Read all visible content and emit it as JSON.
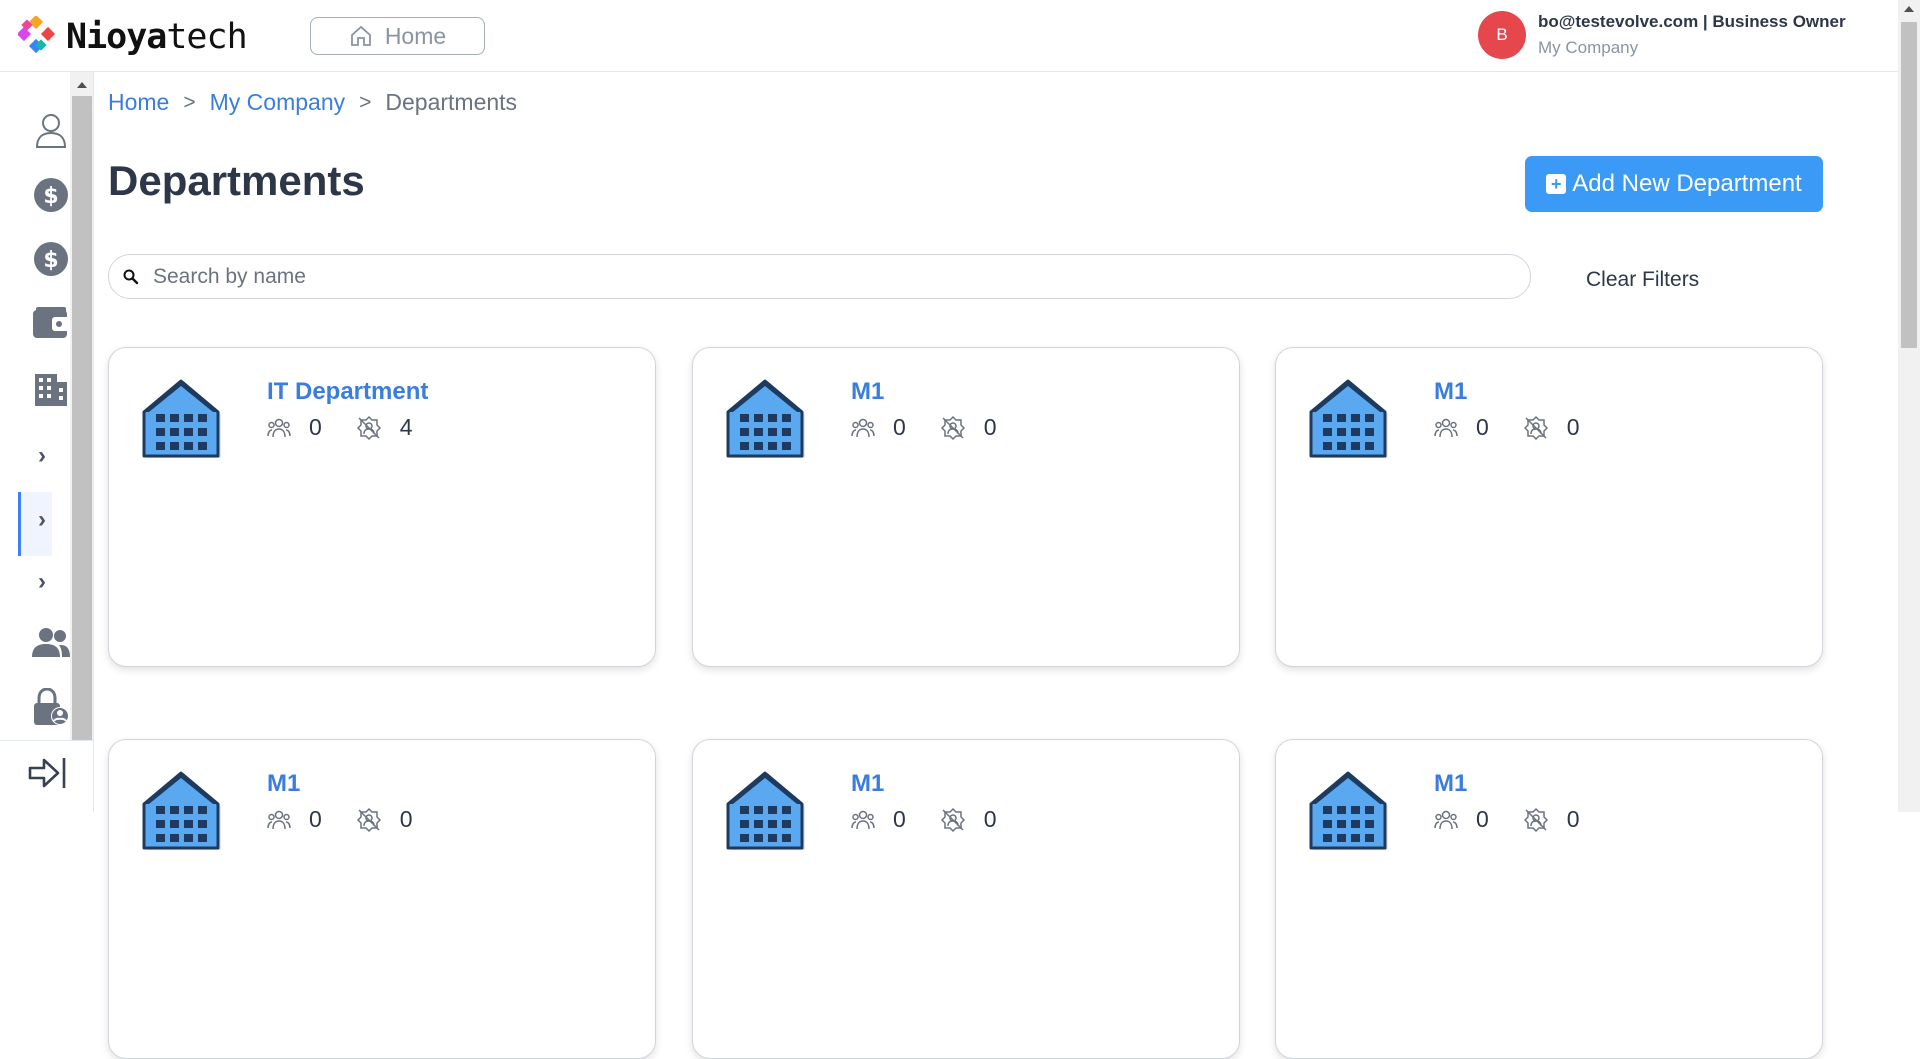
{
  "header": {
    "logo_bold": "Nioya",
    "logo_light": "tech",
    "home_label": "Home",
    "user_initial": "B",
    "user_title": "bo@testevolve.com | Business Owner",
    "user_company": "My Company"
  },
  "sidebar": {
    "icons": [
      "user-icon",
      "dollar-icon",
      "dollar-icon",
      "wallet-icon",
      "building-icon",
      "chevron-right-icon",
      "chevron-right-icon",
      "chevron-right-icon",
      "users-icon",
      "lock-user-icon"
    ],
    "bottom_icon": "sign-out-icon"
  },
  "breadcrumb": {
    "home": "Home",
    "sep1": ">",
    "company": "My Company",
    "sep2": ">",
    "current": "Departments"
  },
  "page": {
    "title": "Departments",
    "add_button": "Add New Department",
    "search_placeholder": "Search by name",
    "clear_filters": "Clear Filters"
  },
  "departments": [
    {
      "name": "IT Department",
      "members": "0",
      "roles": "4"
    },
    {
      "name": "M1",
      "members": "0",
      "roles": "0"
    },
    {
      "name": "M1",
      "members": "0",
      "roles": "0"
    },
    {
      "name": "M1",
      "members": "0",
      "roles": "0"
    },
    {
      "name": "M1",
      "members": "0",
      "roles": "0"
    },
    {
      "name": "M1",
      "members": "0",
      "roles": "0"
    }
  ],
  "colors": {
    "accent": "#3a9af5",
    "link": "#3b7ddd",
    "avatar": "#e5474d"
  }
}
